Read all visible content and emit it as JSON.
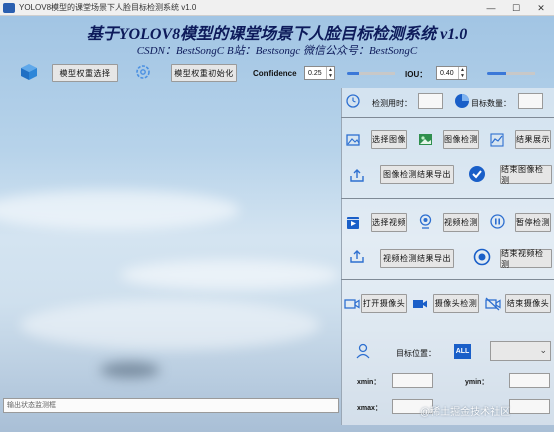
{
  "window": {
    "title": "YOLOV8模型的课堂场景下人脸目标检测系统 v1.0",
    "controls": [
      "—",
      "☐",
      "✕"
    ]
  },
  "header": {
    "title": "基于YOLOV8模型的课堂场景下人脸目标检测系统 v1.0",
    "subtitle": "CSDN：BestSongC   B站：Bestsongc   微信公众号：BestSongC"
  },
  "toolbar": {
    "select_weights": "模型权重选择",
    "init_weights": "模型权重初始化",
    "confidence_label": "Confidence",
    "confidence_value": "0.25",
    "iou_label": "IOU：",
    "iou_value": "0.40",
    "confidence_level": 0.25,
    "iou_level": 0.4
  },
  "panel": {
    "detect_time_label": "检测用时：",
    "target_count_label": "目标数量：",
    "select_image": "选择图像",
    "image_detect": "图像检测",
    "show_result": "结果展示",
    "export_image_result": "图像检测结果导出",
    "end_image_detect": "结束图像检测",
    "select_video": "选择视频",
    "video_detect": "视频检测",
    "pause_detect": "暂停检测",
    "export_video_result": "视频检测结果导出",
    "end_video_detect": "结束视频检测",
    "open_camera": "打开摄像头",
    "camera_detect": "摄像头检测",
    "end_camera_detect": "结束摄像头",
    "target_position_label": "目标位置：",
    "all_badge": "ALL",
    "xmin": "xmin：",
    "ymin": "ymin：",
    "xmax": "xmax："
  },
  "status": {
    "placeholder": "输出状态监测框"
  },
  "watermark": "@稀土掘金技术社区",
  "colors": {
    "title_color": "#0d1a5a",
    "accent": "#3b78d8",
    "pie_blue": "#1a5fc8"
  }
}
